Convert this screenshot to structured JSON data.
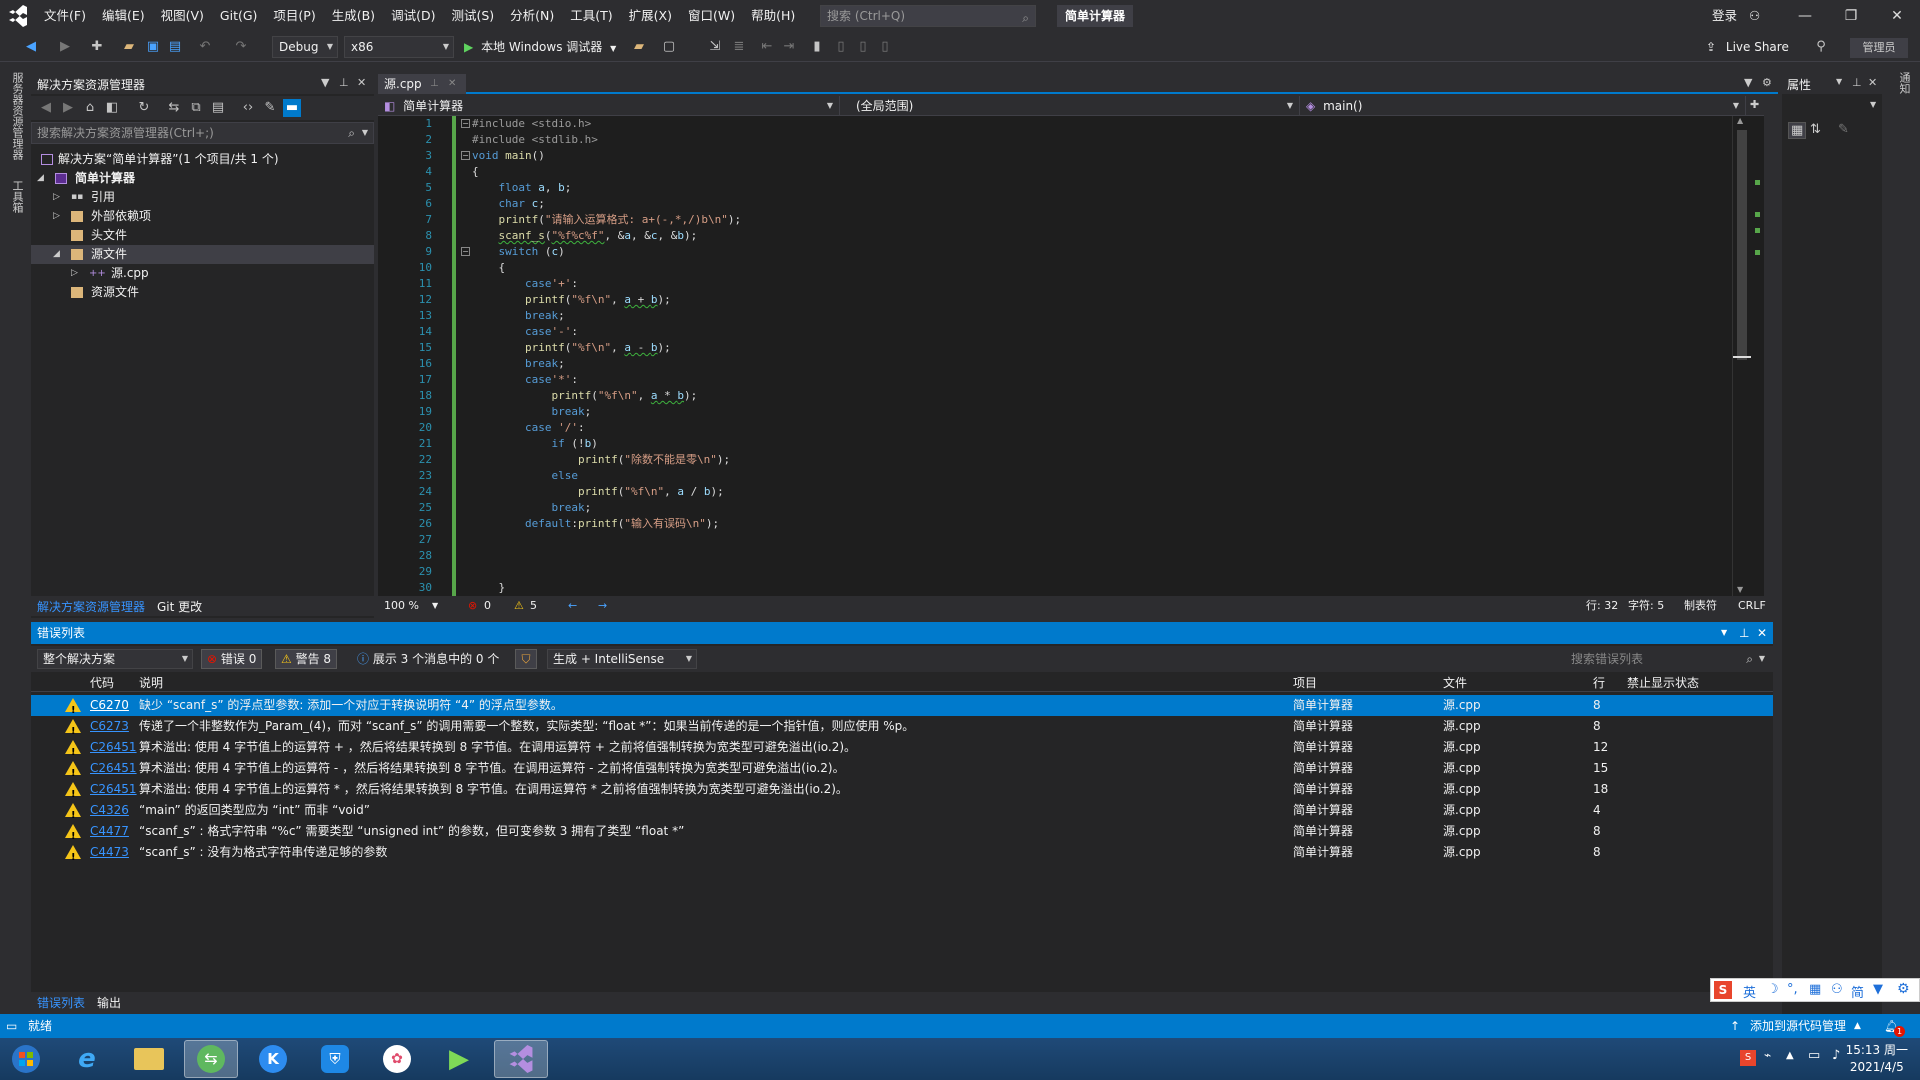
{
  "titlebar": {
    "menu": [
      "文件(F)",
      "编辑(E)",
      "视图(V)",
      "Git(G)",
      "项目(P)",
      "生成(B)",
      "调试(D)",
      "测试(S)",
      "分析(N)",
      "工具(T)",
      "扩展(X)",
      "窗口(W)",
      "帮助(H)"
    ],
    "search_placeholder": "搜索 (Ctrl+Q)",
    "solution_name": "简单计算器",
    "login": "登录"
  },
  "toolbar": {
    "config": "Debug",
    "platform": "x86",
    "run_label": "本地 Windows 调试器",
    "live_share": "Live Share",
    "admin": "管理员"
  },
  "left_strip": {
    "server_explorer": "服务器资源管理器",
    "toolbox": "工具箱"
  },
  "solution_explorer": {
    "title": "解决方案资源管理器",
    "search_placeholder": "搜索解决方案资源管理器(Ctrl+;)",
    "items": [
      {
        "label": "解决方案“简单计算器”(1 个项目/共 1 个)"
      },
      {
        "label": "简单计算器"
      },
      {
        "label": "引用"
      },
      {
        "label": "外部依赖项"
      },
      {
        "label": "头文件"
      },
      {
        "label": "源文件"
      },
      {
        "label": "源.cpp"
      },
      {
        "label": "资源文件"
      }
    ],
    "tab_active": "解决方案资源管理器",
    "tab_git": "Git 更改"
  },
  "editor": {
    "file_tab": "源.cpp",
    "nav_project": "简单计算器",
    "nav_scope": "(全局范围)",
    "nav_member": "main()",
    "zoom": "100 %",
    "errors": "0",
    "warnings": "5",
    "row": "行: 32",
    "col": "字符: 5",
    "tabs": "制表符",
    "eol": "CRLF",
    "line_numbers": [
      "1",
      "2",
      "3",
      "4",
      "5",
      "6",
      "7",
      "8",
      "9",
      "10",
      "11",
      "12",
      "13",
      "14",
      "15",
      "16",
      "17",
      "18",
      "19",
      "20",
      "21",
      "22",
      "23",
      "24",
      "25",
      "26",
      "27",
      "28",
      "29",
      "30"
    ]
  },
  "properties": {
    "title": "属性",
    "strip_label": "通知"
  },
  "error_list": {
    "title": "错误列表",
    "scope": "整个解决方案",
    "errors_btn": "错误 0",
    "warnings_btn": "警告 8",
    "messages_btn": "展示 3 个消息中的 0 个",
    "build_filter": "生成 + IntelliSense",
    "search_placeholder": "搜索错误列表",
    "columns": {
      "code": "代码",
      "desc": "说明",
      "project": "项目",
      "file": "文件",
      "line": "行",
      "suppress": "禁止显示状态"
    },
    "rows": [
      {
        "code": "C6270",
        "desc": "缺少 “scanf_s” 的浮点型参数: 添加一个对应于转换说明符 “4” 的浮点型参数。",
        "project": "简单计算器",
        "file": "源.cpp",
        "line": "8"
      },
      {
        "code": "C6273",
        "desc": "传递了一个非整数作为_Param_(4)，而对 “scanf_s” 的调用需要一个整数，实际类型: “float *”：如果当前传递的是一个指针值，则应使用 %p。",
        "project": "简单计算器",
        "file": "源.cpp",
        "line": "8"
      },
      {
        "code": "C26451",
        "desc": "算术溢出: 使用 4 字节值上的运算符 + ，然后将结果转换到 8 字节值。在调用运算符 + 之前将值强制转换为宽类型可避免溢出(io.2)。",
        "project": "简单计算器",
        "file": "源.cpp",
        "line": "12"
      },
      {
        "code": "C26451",
        "desc": "算术溢出: 使用 4 字节值上的运算符 - ，然后将结果转换到 8 字节值。在调用运算符 - 之前将值强制转换为宽类型可避免溢出(io.2)。",
        "project": "简单计算器",
        "file": "源.cpp",
        "line": "15"
      },
      {
        "code": "C26451",
        "desc": "算术溢出: 使用 4 字节值上的运算符 * ，然后将结果转换到 8 字节值。在调用运算符 * 之前将值强制转换为宽类型可避免溢出(io.2)。",
        "project": "简单计算器",
        "file": "源.cpp",
        "line": "18"
      },
      {
        "code": "C4326",
        "desc": " “main” 的返回类型应为 “int” 而非 “void”",
        "project": "简单计算器",
        "file": "源.cpp",
        "line": "4"
      },
      {
        "code": "C4477",
        "desc": " “scanf_s” : 格式字符串 “%c” 需要类型 “unsigned int” 的参数，但可变参数 3 拥有了类型 “float *”",
        "project": "简单计算器",
        "file": "源.cpp",
        "line": "8"
      },
      {
        "code": "C4473",
        "desc": " “scanf_s” : 没有为格式字符串传递足够的参数",
        "project": "简单计算器",
        "file": "源.cpp",
        "line": "8"
      }
    ],
    "tab_errors": "错误列表",
    "tab_output": "输出"
  },
  "ime": {
    "lang": "英",
    "mode": "简"
  },
  "statusbar": {
    "ready": "就绪",
    "add_source_control": "添加到源代码管理",
    "notify_count": "1"
  },
  "taskbar": {
    "time": "15:13 周一",
    "date": "2021/4/5"
  },
  "colors": {
    "accent": "#007acc",
    "selection": "#3f3f46",
    "warning": "#f5c518",
    "run_green": "#5fd35f",
    "change_bar": "#57a64a"
  }
}
